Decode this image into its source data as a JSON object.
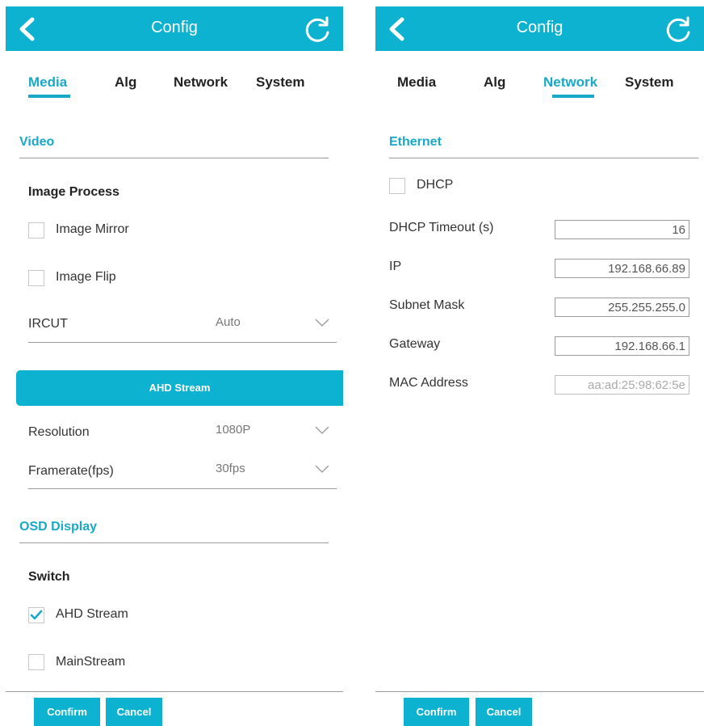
{
  "left": {
    "header": {
      "title": "Config",
      "back_icon": "chevron-left-icon",
      "refresh_icon": "refresh-icon"
    },
    "tabs": [
      {
        "label": "Media",
        "active": true
      },
      {
        "label": "Alg",
        "active": false
      },
      {
        "label": "Network",
        "active": false
      },
      {
        "label": "System",
        "active": false
      }
    ],
    "video": {
      "title": "Video",
      "image_process": {
        "title": "Image Process",
        "mirror": {
          "label": "Image Mirror",
          "checked": false
        },
        "flip": {
          "label": "Image Flip",
          "checked": false
        },
        "ircut": {
          "label": "IRCUT",
          "value": "Auto"
        }
      }
    },
    "ahd_stream": {
      "title": "AHD Stream",
      "resolution": {
        "label": "Resolution",
        "value": "1080P"
      },
      "framerate": {
        "label": "Framerate(fps)",
        "value": "30fps"
      }
    },
    "osd": {
      "title": "OSD Display",
      "switch_title": "Switch",
      "ahd_stream": {
        "label": "AHD Stream",
        "checked": true
      },
      "main_stream": {
        "label": "MainStream",
        "checked": false
      }
    },
    "buttons": {
      "confirm": "Confirm",
      "cancel": "Cancel"
    }
  },
  "right": {
    "header": {
      "title": "Config",
      "back_icon": "chevron-left-icon",
      "refresh_icon": "refresh-icon"
    },
    "tabs": [
      {
        "label": "Media",
        "active": false
      },
      {
        "label": "Alg",
        "active": false
      },
      {
        "label": "Network",
        "active": true
      },
      {
        "label": "System",
        "active": false
      }
    ],
    "ethernet": {
      "title": "Ethernet",
      "dhcp": {
        "label": "DHCP",
        "checked": false
      },
      "fields": [
        {
          "label": "DHCP Timeout (s)",
          "value": "16"
        },
        {
          "label": "IP",
          "value": "192.168.66.89"
        },
        {
          "label": "Subnet Mask",
          "value": "255.255.255.0"
        },
        {
          "label": "Gateway",
          "value": "192.168.66.1"
        },
        {
          "label": "MAC Address",
          "value": "aa:ad:25:98:62:5e"
        }
      ]
    },
    "buttons": {
      "confirm": "Confirm",
      "cancel": "Cancel"
    }
  },
  "colors": {
    "accent": "#0db2d1",
    "tab_active": "#18a8c8",
    "divider": "#9a9a9a"
  }
}
